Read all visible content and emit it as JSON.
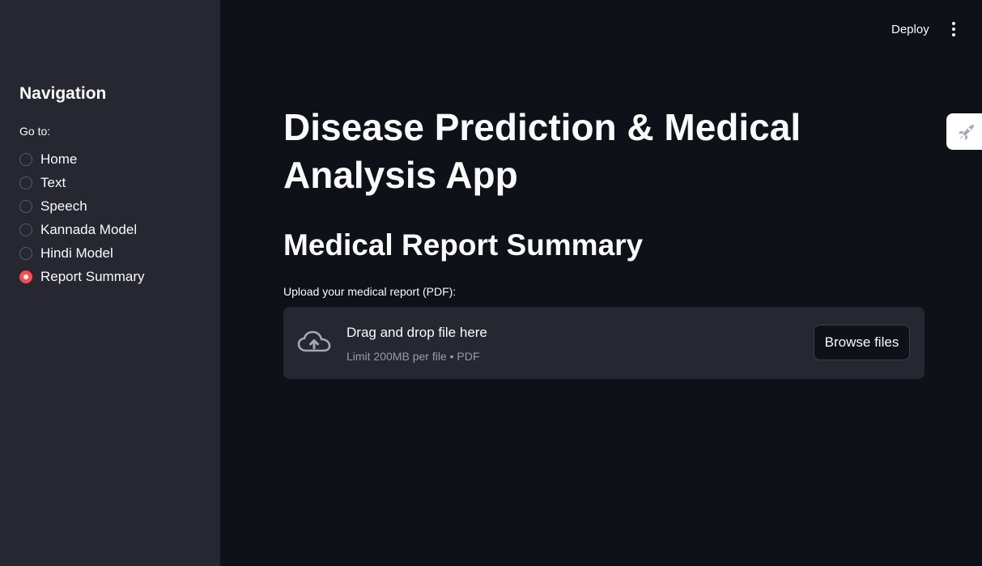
{
  "header": {
    "deploy_label": "Deploy",
    "menu_icon": "vertical-ellipsis-icon"
  },
  "side_tab": {
    "icon": "rocket-icon"
  },
  "sidebar": {
    "title": "Navigation",
    "radio_label": "Go to:",
    "options": [
      {
        "label": "Home",
        "selected": false
      },
      {
        "label": "Text",
        "selected": false
      },
      {
        "label": "Speech",
        "selected": false
      },
      {
        "label": "Kannada Model",
        "selected": false
      },
      {
        "label": "Hindi Model",
        "selected": false
      },
      {
        "label": "Report Summary",
        "selected": true
      }
    ]
  },
  "main": {
    "title": "Disease Prediction & Medical Analysis App",
    "subtitle": "Medical Report Summary",
    "uploader": {
      "label": "Upload your medical report (PDF):",
      "drop_text": "Drag and drop file here",
      "limit_text": "Limit 200MB per file • PDF",
      "browse_label": "Browse files",
      "icon": "cloud-upload-icon"
    }
  },
  "colors": {
    "background": "#0e1117",
    "sidebar": "#262730",
    "accent": "#ff4b4b",
    "text": "#fafafa",
    "muted_text": "#9a9ba4"
  }
}
